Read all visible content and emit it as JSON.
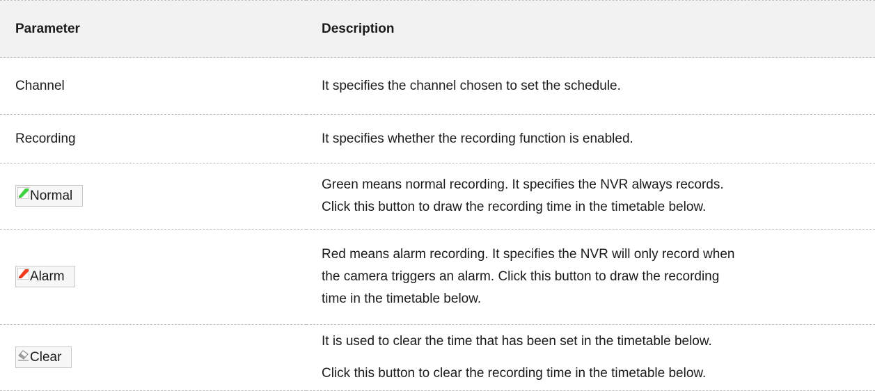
{
  "table": {
    "header": {
      "param": "Parameter",
      "desc": "Description"
    },
    "rows": {
      "channel": {
        "param": "Channel",
        "desc": "It specifies the channel chosen to set the schedule."
      },
      "recording": {
        "param": "Recording",
        "desc": "It specifies whether the recording function is enabled."
      },
      "normal": {
        "button_label": "Normal",
        "icon": "green-pencil-icon",
        "icon_color": "#3fd13f",
        "desc": [
          "Green means normal recording. It specifies the NVR always records.",
          "Click this button to draw the recording time in the timetable below."
        ]
      },
      "alarm": {
        "button_label": "Alarm",
        "icon": "red-pencil-icon",
        "icon_color": "#f23c1f",
        "desc": [
          "Red means alarm recording. It specifies the NVR will only record when",
          "the camera triggers an alarm. Click this button to draw the recording",
          "time in the timetable below."
        ]
      },
      "clear": {
        "button_label": "Clear",
        "icon": "eraser-icon",
        "icon_color": "#9e9e9e",
        "desc": [
          "It is used to clear the time that has been set in the timetable below.",
          "Click this button to clear the recording time in the timetable below."
        ]
      }
    }
  }
}
